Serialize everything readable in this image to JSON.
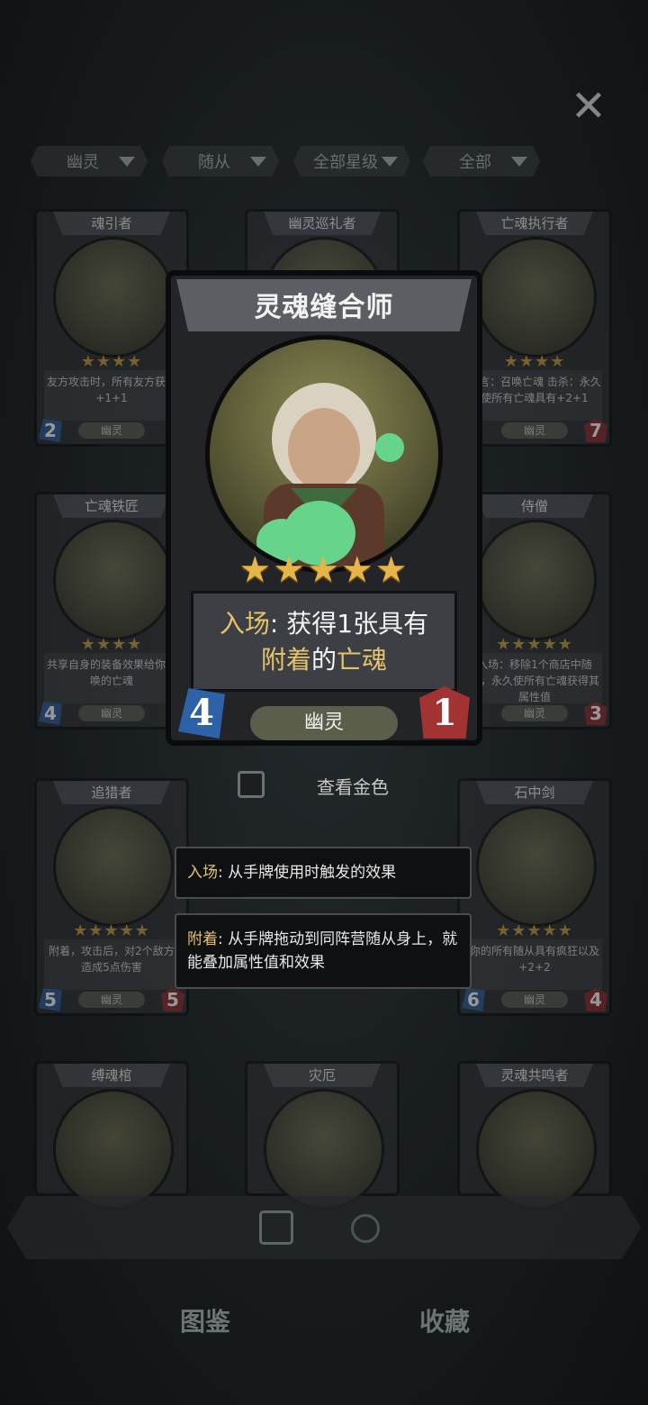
{
  "filters": [
    {
      "label": "幽灵"
    },
    {
      "label": "随从"
    },
    {
      "label": "全部星级"
    },
    {
      "label": "全部"
    }
  ],
  "grid_cards": [
    {
      "name": "魂引者",
      "desc": "友方攻击时，所有友方获得+1+1",
      "cost": "2",
      "race": "幽灵",
      "stars": "★★★★"
    },
    {
      "name": "幽灵巡礼者",
      "desc": "",
      "cost": "",
      "race": "幽灵",
      "stars": ""
    },
    {
      "name": "亡魂执行者",
      "desc": "遗言：召唤亡魂 击杀：永久使所有亡魂具有+2+1",
      "cost": "",
      "atk": "7",
      "race": "幽灵",
      "stars": "★★★★"
    },
    {
      "name": "亡魂铁匠",
      "desc": "共享自身的装备效果给你召唤的亡魂",
      "cost": "4",
      "race": "幽灵",
      "stars": "★★★★"
    },
    {
      "name": "侍僧",
      "desc": "入场：移除1个商店中随从，永久使所有亡魂获得其属性值",
      "cost": "",
      "atk": "3",
      "race": "幽灵",
      "stars": "★★★★★"
    },
    {
      "name": "追猎者",
      "desc": "附着，攻击后，对2个敌方造成5点伤害",
      "cost": "5",
      "atk": "5",
      "race": "幽灵",
      "stars": "★★★★★"
    },
    {
      "name": "石中剑",
      "desc": "你的所有随从具有疯狂以及+2+2",
      "cost": "6",
      "atk": "4",
      "race": "幽灵",
      "stars": "★★★★★"
    },
    {
      "name": "缚魂棺"
    },
    {
      "name": "灾厄"
    },
    {
      "name": "灵魂共鸣者"
    }
  ],
  "featured_card": {
    "name": "灵魂缝合师",
    "stars": "★★★★★",
    "desc_kw1": "入场",
    "desc_text1": ": 获得1张具有",
    "desc_kw2": "附着",
    "desc_text2": "的",
    "desc_kw3": "亡魂",
    "cost": "4",
    "attack": "1",
    "race": "幽灵"
  },
  "view_gold_label": "查看金色",
  "tooltips": [
    {
      "keyword": "入场",
      "text": ": 从手牌使用时触发的效果"
    },
    {
      "keyword": "附着",
      "text": ": 从手牌拖动到同阵营随从身上，就能叠加属性值和效果"
    }
  ],
  "nav": {
    "left": "图鉴",
    "right": "收藏"
  },
  "colors": {
    "keyword": "#e6c36a",
    "star": "#e6b547",
    "cost_blue": "#2e62a8",
    "atk_red": "#a33232"
  }
}
